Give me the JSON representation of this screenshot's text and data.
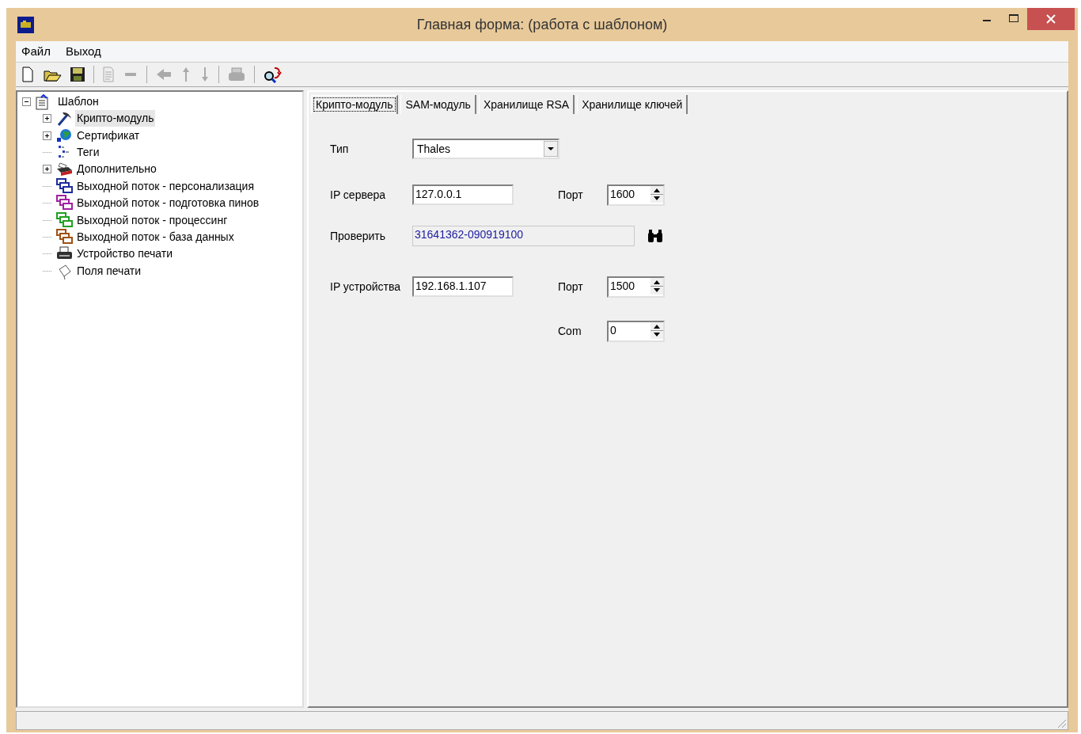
{
  "window": {
    "title": "Главная форма: (работа с шаблоном)"
  },
  "menu": [
    "Файл",
    "Выход"
  ],
  "tree": {
    "label": "Шаблон",
    "expanded": true,
    "children": [
      {
        "label": "Крипто-модуль",
        "expandable": true,
        "selected": true
      },
      {
        "label": "Сертификат",
        "expandable": true,
        "selected": false
      },
      {
        "label": "Теги",
        "expandable": false,
        "selected": false
      },
      {
        "label": "Дополнительно",
        "expandable": true,
        "selected": false
      },
      {
        "label": "Выходной поток - персонализация",
        "expandable": false,
        "selected": false
      },
      {
        "label": "Выходной поток - подготовка пинов",
        "expandable": false,
        "selected": false
      },
      {
        "label": "Выходной поток - процессинг",
        "expandable": false,
        "selected": false
      },
      {
        "label": "Выходной поток - база данных",
        "expandable": false,
        "selected": false
      },
      {
        "label": "Устройство печати",
        "expandable": false,
        "selected": false
      },
      {
        "label": "Поля печати",
        "expandable": false,
        "selected": false
      }
    ]
  },
  "tabs": [
    {
      "label": "Крипто-модуль",
      "selected": true
    },
    {
      "label": "SAM-модуль",
      "selected": false
    },
    {
      "label": "Хранилище RSA",
      "selected": false
    },
    {
      "label": "Хранилище ключей",
      "selected": false
    }
  ],
  "form": {
    "type_label": "Тип",
    "type_value": "Thales",
    "server_ip_label": "IP сервера",
    "server_ip": "127.0.0.1",
    "server_port_label": "Порт",
    "server_port": "1600",
    "check_label": "Проверить",
    "check_value": "31641362-090919100",
    "device_ip_label": "IP устройства",
    "device_ip": "192.168.1.107",
    "device_port_label": "Порт",
    "device_port": "1500",
    "com_label": "Com",
    "com_value": "0"
  }
}
